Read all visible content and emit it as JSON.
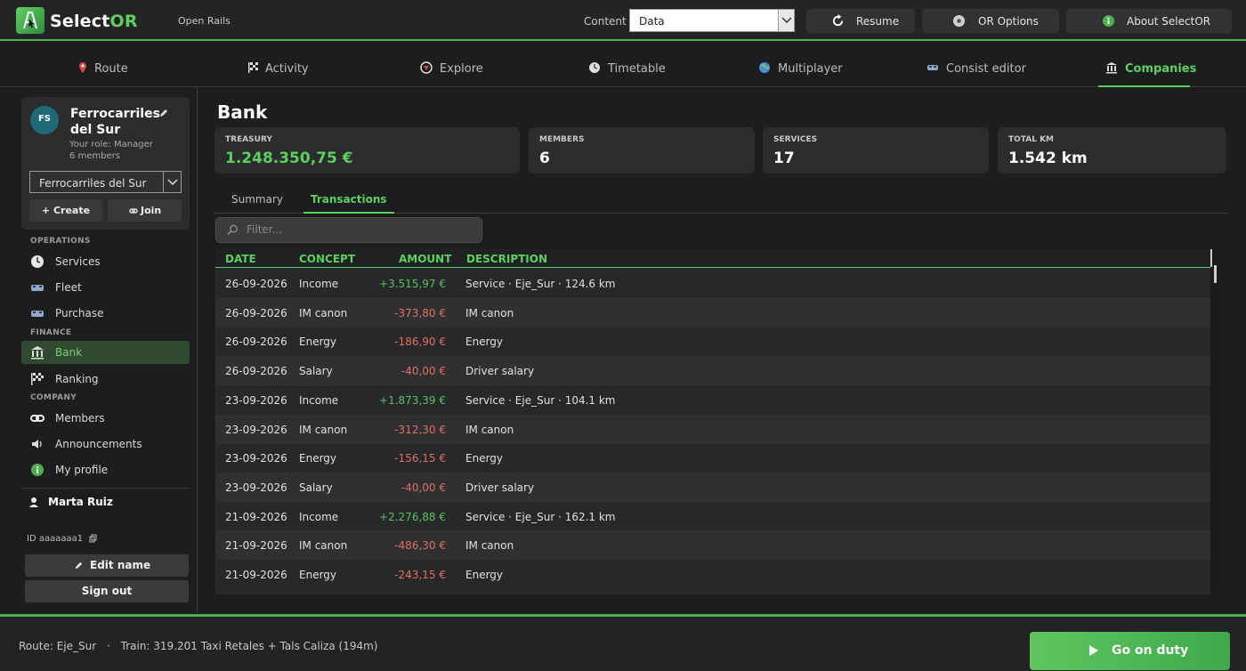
{
  "app": {
    "name_main": "Select",
    "name_accent": "OR",
    "subtitle": "Open Rails"
  },
  "toolbar": {
    "content_label": "Content",
    "content_value": "Data",
    "resume_label": "Resume",
    "options_label": "OR Options",
    "about_label": "About SelectOR"
  },
  "tabs": [
    {
      "label": "Route",
      "icon": "pin-icon"
    },
    {
      "label": "Activity",
      "icon": "checkered-flag-icon"
    },
    {
      "label": "Explore",
      "icon": "compass-icon"
    },
    {
      "label": "Timetable",
      "icon": "clock-icon"
    },
    {
      "label": "Multiplayer",
      "icon": "globe-icon"
    },
    {
      "label": "Consist editor",
      "icon": "train-icon"
    },
    {
      "label": "Companies",
      "icon": "bank-icon",
      "active": true
    }
  ],
  "company": {
    "initials": "FS",
    "name": "Ferrocarriles del Sur",
    "role": "Your role: Manager",
    "members": "6 members",
    "selected": "Ferrocarriles del Sur",
    "create_label": "+ Create",
    "join_label": "Join"
  },
  "sidebar": {
    "operations_label": "OPERATIONS",
    "finance_label": "FINANCE",
    "company_label": "COMPANY",
    "items": {
      "services": "Services",
      "fleet": "Fleet",
      "purchase": "Purchase",
      "bank": "Bank",
      "ranking": "Ranking",
      "members": "Members",
      "announcements": "Announcements",
      "profile": "My profile"
    },
    "user_name": "Marta Ruiz",
    "user_id": "ID aaaaaaa1",
    "edit_name_label": "Edit name",
    "sign_out_label": "Sign out"
  },
  "bank": {
    "title": "Bank",
    "stats": {
      "treasury_label": "TREASURY",
      "treasury_value": "1.248.350,75 €",
      "members_label": "MEMBERS",
      "members_value": "6",
      "services_label": "SERVICES",
      "services_value": "17",
      "km_label": "TOTAL KM",
      "km_value": "1.542 km"
    },
    "subtabs": {
      "summary": "Summary",
      "transactions": "Transactions"
    },
    "filter_placeholder": "Filter...",
    "columns": {
      "date": "DATE",
      "concept": "CONCEPT",
      "amount": "AMOUNT",
      "description": "DESCRIPTION"
    },
    "rows": [
      {
        "date": "26-09-2026",
        "concept": "Income",
        "amount": "+3.515,97 €",
        "description": "Service · Eje_Sur · 124.6 km"
      },
      {
        "date": "26-09-2026",
        "concept": "IM canon",
        "amount": "-373,80 €",
        "description": "IM canon"
      },
      {
        "date": "26-09-2026",
        "concept": "Energy",
        "amount": "-186,90 €",
        "description": "Energy"
      },
      {
        "date": "26-09-2026",
        "concept": "Salary",
        "amount": "-40,00 €",
        "description": "Driver salary"
      },
      {
        "date": "23-09-2026",
        "concept": "Income",
        "amount": "+1.873,39 €",
        "description": "Service · Eje_Sur · 104.1 km"
      },
      {
        "date": "23-09-2026",
        "concept": "IM canon",
        "amount": "-312,30 €",
        "description": "IM canon"
      },
      {
        "date": "23-09-2026",
        "concept": "Energy",
        "amount": "-156,15 €",
        "description": "Energy"
      },
      {
        "date": "23-09-2026",
        "concept": "Salary",
        "amount": "-40,00 €",
        "description": "Driver salary"
      },
      {
        "date": "21-09-2026",
        "concept": "Income",
        "amount": "+2.276,88 €",
        "description": "Service · Eje_Sur · 162.1 km"
      },
      {
        "date": "21-09-2026",
        "concept": "IM canon",
        "amount": "-486,30 €",
        "description": "IM canon"
      },
      {
        "date": "21-09-2026",
        "concept": "Energy",
        "amount": "-243,15 €",
        "description": "Energy"
      }
    ]
  },
  "footer": {
    "route": "Route: Eje_Sur",
    "sep": "·",
    "train": "Train: 319.201 Taxi Retales + Tals Caliza (194m)",
    "duty_label": "Go on duty"
  },
  "colors": {
    "accent": "#5cd05c",
    "positive": "#5cc05c",
    "negative": "#e07060"
  }
}
